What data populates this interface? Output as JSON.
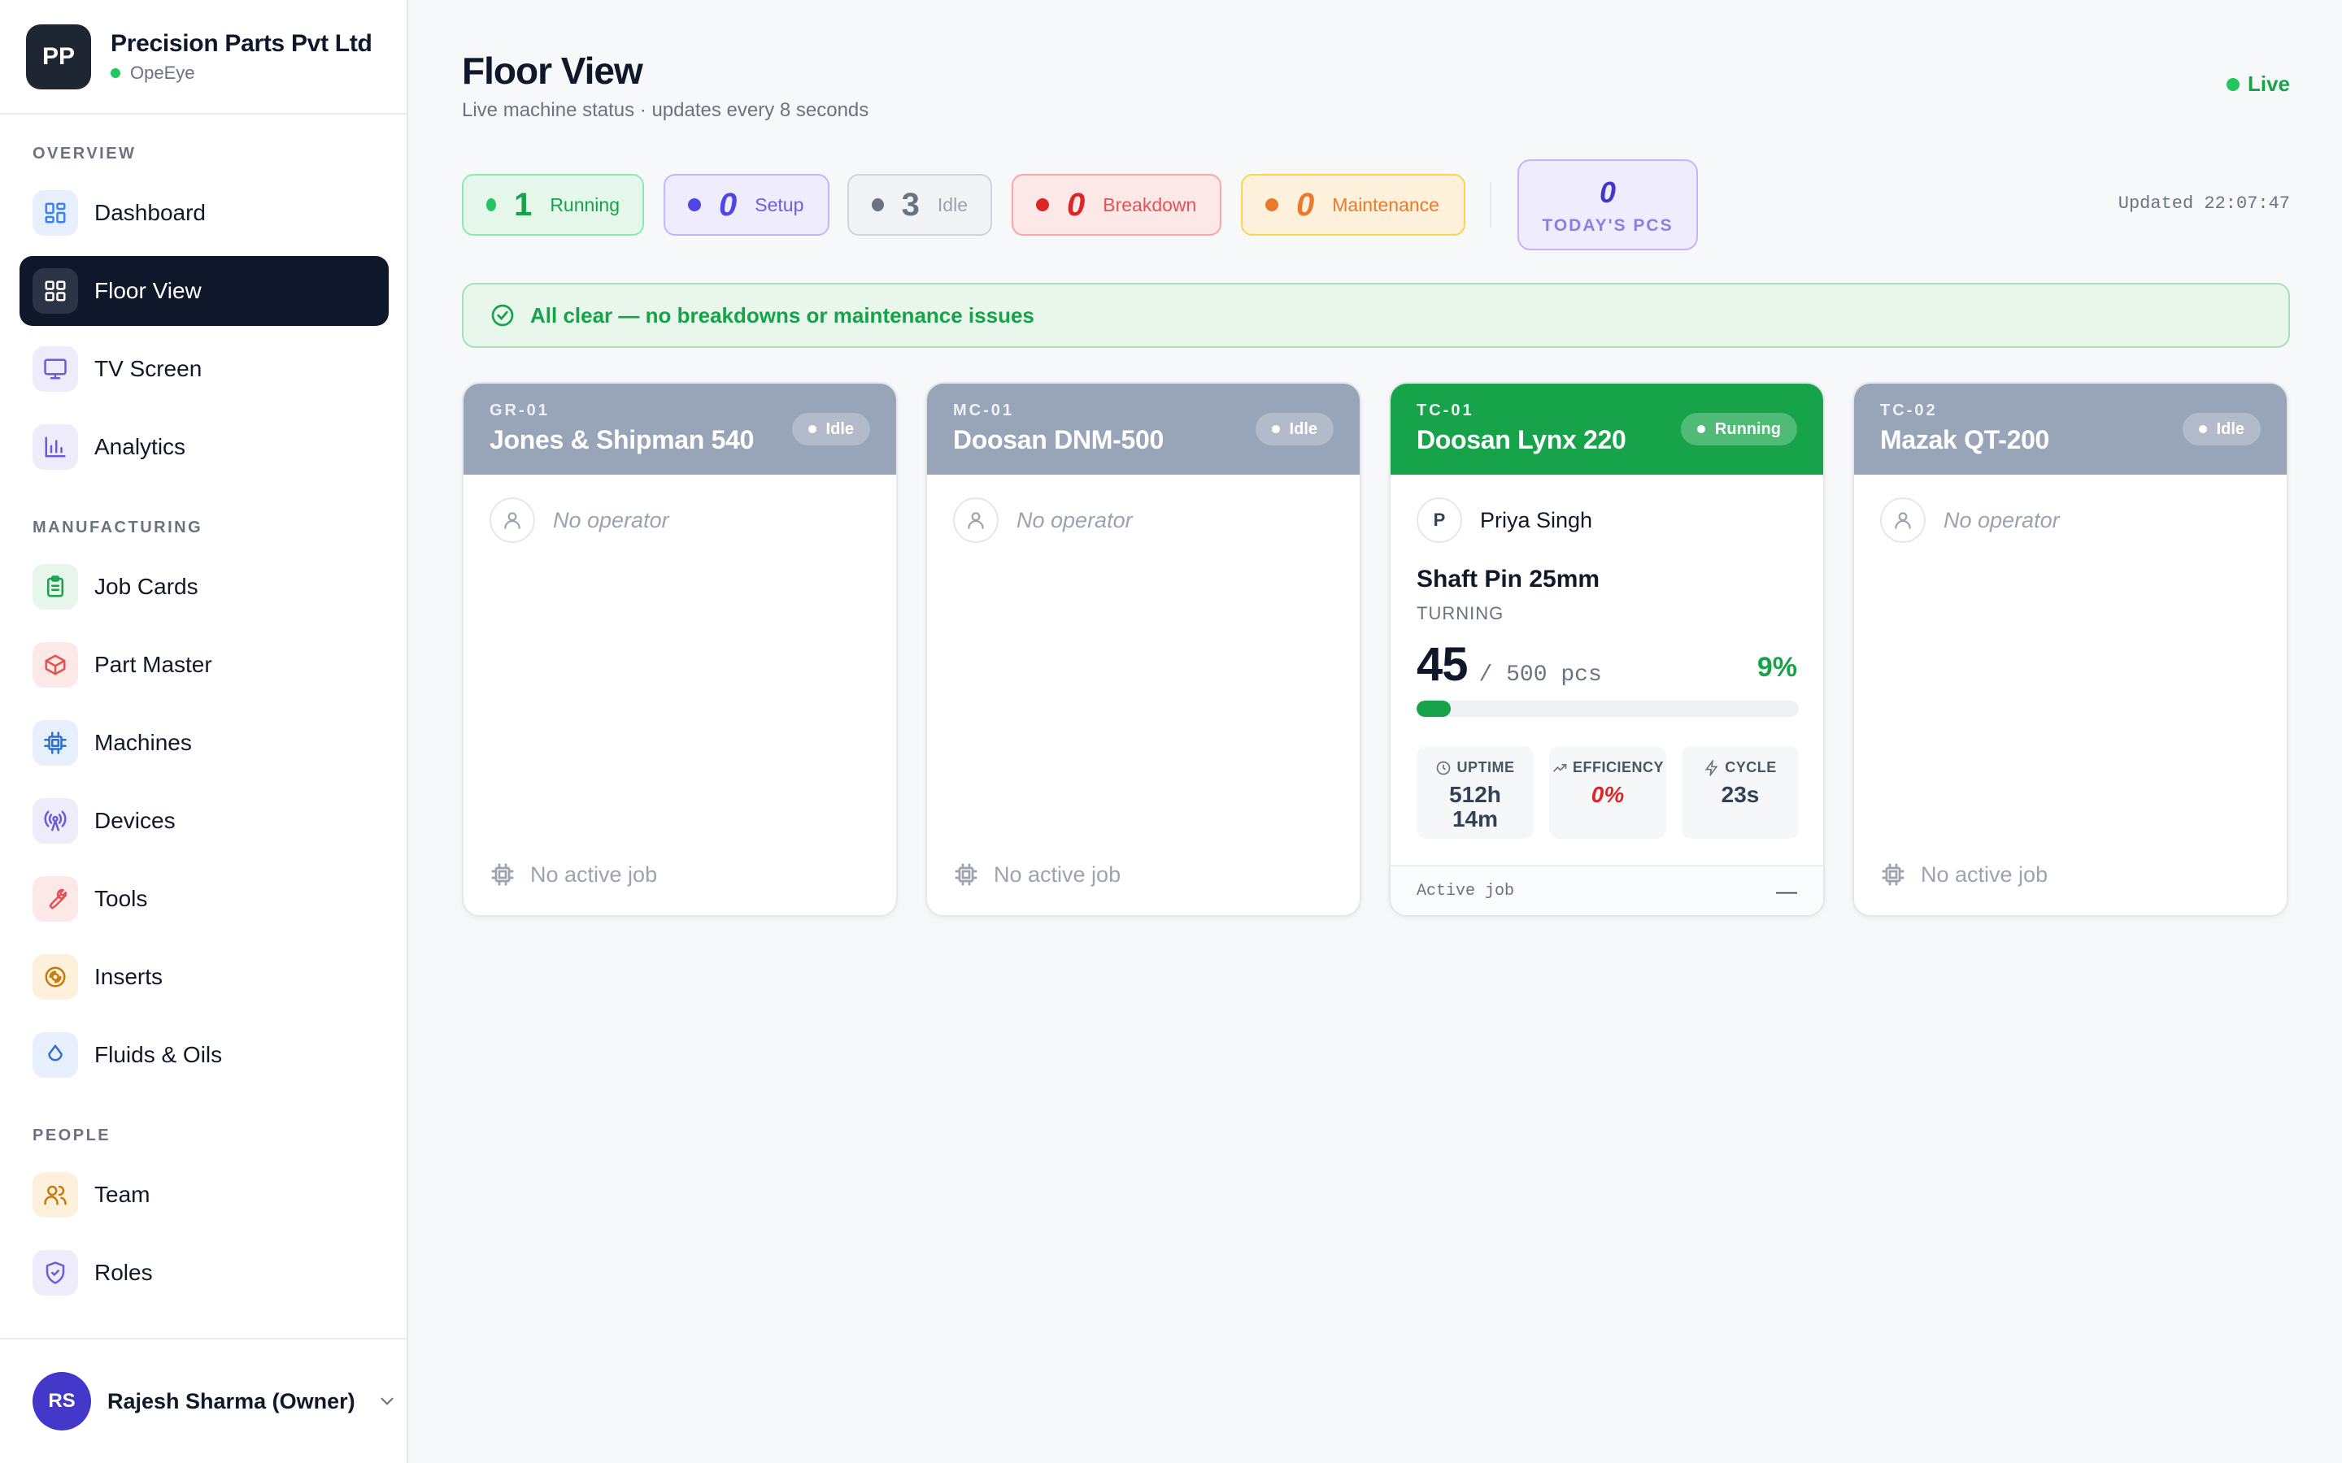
{
  "brand": {
    "initials": "PP",
    "name": "Precision Parts Pvt Ltd",
    "app": "OpeEye"
  },
  "sidebar": {
    "sections": {
      "overview": "OVERVIEW",
      "manufacturing": "MANUFACTURING",
      "people": "PEOPLE"
    },
    "items": [
      {
        "label": "Dashboard",
        "icon": "dashboard-icon",
        "color": "#3b82f6",
        "bg": "#e8effc"
      },
      {
        "label": "Floor View",
        "icon": "grid-icon",
        "color": "#ffffff",
        "bg": "#1e2533",
        "active": true
      },
      {
        "label": "TV Screen",
        "icon": "monitor-icon",
        "color": "#6b5bd6",
        "bg": "#eeecfb"
      },
      {
        "label": "Analytics",
        "icon": "bar-chart-icon",
        "color": "#6b5bd6",
        "bg": "#eeecfb"
      },
      {
        "label": "Job Cards",
        "icon": "clipboard-icon",
        "color": "#16a34a",
        "bg": "#e6f6ea"
      },
      {
        "label": "Part Master",
        "icon": "box-icon",
        "color": "#e35353",
        "bg": "#fde8e8"
      },
      {
        "label": "Machines",
        "icon": "cpu-icon",
        "color": "#2f6fcf",
        "bg": "#e8effc"
      },
      {
        "label": "Devices",
        "icon": "antenna-icon",
        "color": "#6b5bd6",
        "bg": "#eeecfb"
      },
      {
        "label": "Tools",
        "icon": "wrench-icon",
        "color": "#e35353",
        "bg": "#fde8e8"
      },
      {
        "label": "Inserts",
        "icon": "disc-icon",
        "color": "#c77a0c",
        "bg": "#fdf1dc"
      },
      {
        "label": "Fluids & Oils",
        "icon": "droplet-icon",
        "color": "#2f6fcf",
        "bg": "#e8effc"
      },
      {
        "label": "Team",
        "icon": "users-icon",
        "color": "#c77a0c",
        "bg": "#fdf1dc"
      },
      {
        "label": "Roles",
        "icon": "shield-icon",
        "color": "#6b5bd6",
        "bg": "#eeecfb"
      }
    ]
  },
  "user": {
    "initials": "RS",
    "name": "Rajesh Sharma (Owner)"
  },
  "header": {
    "title": "Floor View",
    "subtitle": "Live machine status · updates every 8 seconds",
    "live": "Live",
    "updated": "Updated 22:07:47"
  },
  "stats": {
    "running": {
      "count": "1",
      "label": "Running"
    },
    "setup": {
      "count": "0",
      "label": "Setup"
    },
    "idle": {
      "count": "3",
      "label": "Idle"
    },
    "breakdown": {
      "count": "0",
      "label": "Breakdown"
    },
    "maintenance": {
      "count": "0",
      "label": "Maintenance"
    },
    "todays_pcs": {
      "count": "0",
      "label": "TODAY'S PCS"
    }
  },
  "banner": {
    "text": "All clear — no breakdowns or maintenance issues"
  },
  "machines": [
    {
      "code": "GR-01",
      "name": "Jones & Shipman 540",
      "status": "Idle",
      "operator": "No operator",
      "footer": "No active job"
    },
    {
      "code": "MC-01",
      "name": "Doosan DNM-500",
      "status": "Idle",
      "operator": "No operator",
      "footer": "No active job"
    },
    {
      "code": "TC-01",
      "name": "Doosan Lynx 220",
      "status": "Running",
      "operator": "Priya Singh",
      "operator_initial": "P",
      "part": "Shaft Pin 25mm",
      "operation": "TURNING",
      "qty_done": "45",
      "qty_target": "/ 500 pcs",
      "percent": "9%",
      "progress": 0.09,
      "stats": [
        {
          "label": "UPTIME",
          "value": "512h 14m"
        },
        {
          "label": "EFFICIENCY",
          "value": "0%"
        },
        {
          "label": "CYCLE",
          "value": "23s"
        }
      ],
      "footer_label": "Active job",
      "footer_value": "—"
    },
    {
      "code": "TC-02",
      "name": "Mazak QT-200",
      "status": "Idle",
      "operator": "No operator",
      "footer": "No active job"
    }
  ]
}
